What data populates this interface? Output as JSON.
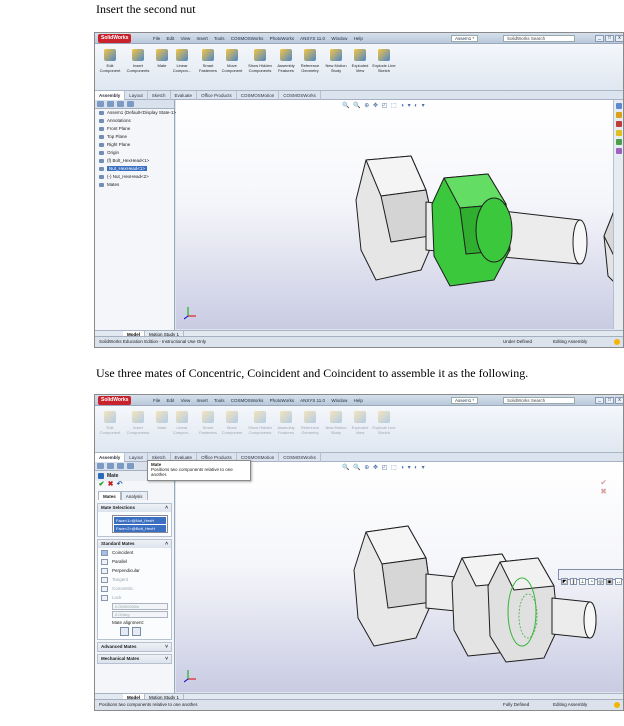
{
  "captions": {
    "step1": "Insert the second nut",
    "step2": "Use three mates of Concentric, Coincident and Coincident to assemble it as the following."
  },
  "app": {
    "brand": "SolidWorks",
    "menus": [
      "File",
      "Edit",
      "View",
      "Insert",
      "Tools",
      "COSMOSWorks",
      "PhotoWorks",
      "ANSYS 11.0",
      "Window",
      "Help"
    ],
    "document": "Assem1 *",
    "search_placeholder": "SolidWorks Search",
    "window_buttons": [
      "_",
      "□",
      "x"
    ]
  },
  "toolbar": {
    "tools": [
      "Edit Component",
      "Insert Components",
      "Mate",
      "Linear Compon...",
      "Smart Fasteners",
      "Move Component",
      "Show Hidden Components",
      "Assembly Features",
      "Reference Geometry",
      "New Motion Study",
      "Exploded View",
      "Explode Line Sketch"
    ]
  },
  "tabs": [
    "Assembly",
    "Layout",
    "Sketch",
    "Evaluate",
    "Office Products",
    "COSMOSMotion",
    "COSMOSWorks"
  ],
  "screen1": {
    "tree": [
      "Assem1 (Default<Display State-1>)",
      "Annotations",
      "Front Plane",
      "Top Plane",
      "Right Plane",
      "Origin",
      "(f) Bolt_HexHead<1>",
      "Nut_HexHead<1>",
      "(-) Nut_HexHead<2>",
      "Mates"
    ],
    "selected_index": 7,
    "status_left": "SolidWorks Education Edition - Instructional Use Only",
    "status_right1": "Under Defined",
    "status_right2": "Editing Assembly"
  },
  "screen2": {
    "pm_title": "Mate",
    "pm_tabs": [
      "Mates",
      "Analysis"
    ],
    "mate_selections_label": "Mate Selections",
    "selections": [
      "Face<1>@Nut_HexH",
      "Face<2>@Bolt_HexH"
    ],
    "standard_mates_label": "Standard Mates",
    "mates": [
      "Coincident",
      "Parallel",
      "Perpendicular",
      "Tangent",
      "Concentric",
      "Lock"
    ],
    "field1": "0.00000000in",
    "field2": "0.00deg",
    "mate_alignment_label": "Mate alignment:",
    "advanced_label": "Advanced Mates",
    "mechanical_label": "Mechanical Mates",
    "tooltip_title": "Mate",
    "tooltip_text": "Positions two components relative to one another.",
    "status_left": "Positions two components relative to one another.",
    "status_right1": "Fully Defined",
    "status_right2": "Editing Assembly",
    "breadcrumb": "Assem1 (Default<Display St..."
  },
  "bottom_tabs": [
    "Model",
    "Motion Study 1"
  ],
  "heads_up_icons": "🔍 🔍 ⊕ ✥ ◰ ⬚ ◑ ▾ ◐ ▾",
  "colors": {
    "selected_nut": "#3cc83c",
    "part_face": "#e3e3e3",
    "part_edge": "#1e1e1e"
  }
}
